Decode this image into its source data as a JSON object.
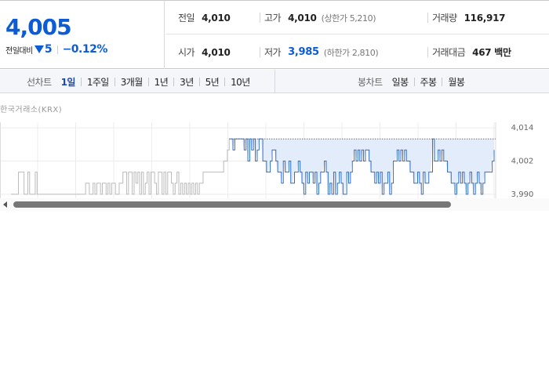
{
  "summary": {
    "price": "4,005",
    "change_label": "전일대비",
    "change_amount": "5",
    "change_percent": "−0.12%",
    "row1": {
      "prev_close_label": "전일",
      "prev_close_value": "4,010",
      "high_label": "고가",
      "high_value": "4,010",
      "upper_limit": "(상한가 5,210)",
      "volume_label": "거래량",
      "volume_value": "116,917"
    },
    "row2": {
      "open_label": "시가",
      "open_value": "4,010",
      "low_label": "저가",
      "low_value": "3,985",
      "lower_limit": "(하한가 2,810)",
      "trade_value_label": "거래대금",
      "trade_value_value": "467 백만"
    }
  },
  "tabs": {
    "line_caption": "선차트",
    "line_periods": [
      "1일",
      "1주일",
      "3개월",
      "1년",
      "3년",
      "5년",
      "10년"
    ],
    "line_active": 0,
    "candle_caption": "봉차트",
    "candle_periods": [
      "일봉",
      "주봉",
      "월봉"
    ]
  },
  "exchange_label": "한국거래소(KRX)",
  "chart_data": {
    "type": "line",
    "ytick_labels": [
      "4,014",
      "4,002",
      "3,990"
    ],
    "yticks": [
      4014,
      4002,
      3990
    ],
    "ylim": [
      3988,
      4016
    ],
    "reference": 4010,
    "x_count": 260,
    "series": [
      {
        "values": [
          3990,
          3990,
          3990,
          3990,
          3998,
          3998,
          3998,
          3990,
          3990,
          3998,
          3990,
          3990,
          3990,
          3998,
          3990,
          3990,
          3990,
          3990,
          3990,
          3990,
          3990,
          3990,
          3990,
          3990,
          3990,
          3990,
          3990,
          3990,
          3990,
          3990,
          3990,
          3990,
          3990,
          3990,
          3990,
          3990,
          3990,
          3990,
          3990,
          3990,
          3994,
          3994,
          3990,
          3990,
          3994,
          3990,
          3994,
          3994,
          3990,
          3994,
          3994,
          3990,
          3994,
          3990,
          3994,
          3994,
          3990,
          3990,
          3994,
          3994,
          3998,
          3998,
          3990,
          3998,
          3998,
          3990,
          3998,
          3994,
          3998,
          3990,
          3998,
          3990,
          3994,
          3998,
          3990,
          3998,
          3998,
          3994,
          3990,
          3998,
          3998,
          3990,
          3998,
          3990,
          3998,
          3998,
          3994,
          3990,
          3994,
          3998,
          3990,
          3994,
          3990,
          3994,
          3990,
          3994,
          3990,
          3994,
          3990,
          3994,
          3990,
          3994,
          3994,
          3998,
          3998,
          3998,
          3998,
          3998,
          3998,
          3998,
          3998,
          3998,
          3998,
          3998,
          4002,
          4002,
          4006,
          4010,
          4010,
          4006,
          4010,
          4010,
          4010,
          4010,
          4010,
          4006,
          4010,
          4002,
          4010,
          4006,
          4010,
          4002,
          4006,
          4010,
          4010,
          4002,
          4002,
          3998,
          3998,
          4002,
          4006,
          4006,
          4002,
          3998,
          3998,
          3994,
          4002,
          3998,
          3998,
          4002,
          3994,
          3994,
          3998,
          3998,
          4002,
          3998,
          3994,
          3990,
          3998,
          3994,
          3998,
          3998,
          3994,
          3998,
          3990,
          3994,
          3998,
          3998,
          4002,
          3998,
          3990,
          3994,
          3990,
          3998,
          3990,
          3994,
          3998,
          3994,
          3990,
          3990,
          3998,
          3994,
          3998,
          4002,
          4006,
          4002,
          4006,
          4002,
          4006,
          4002,
          4006,
          4006,
          4002,
          3998,
          3998,
          3994,
          3998,
          3994,
          3998,
          3990,
          3994,
          3994,
          3998,
          3990,
          3994,
          4002,
          4002,
          4006,
          4002,
          4006,
          4002,
          4006,
          4002,
          4002,
          3998,
          3998,
          3994,
          3994,
          3998,
          3994,
          3990,
          3998,
          3994,
          3994,
          3998,
          3998,
          4010,
          4002,
          4002,
          4006,
          4002,
          4006,
          4002,
          4002,
          3998,
          3998,
          3994,
          3994,
          3990,
          3994,
          3998,
          3994,
          3998,
          3994,
          3990,
          3994,
          3998,
          3994,
          3990,
          3994,
          3998,
          3994,
          3990,
          3994,
          3998,
          3998,
          3998,
          3998,
          4002,
          4006
        ]
      }
    ]
  },
  "colors": {
    "price_down": "#0c5cd6",
    "line_before": "#bbbbbb",
    "line_after": "#2f6fd0",
    "fill": "#e3ecfa",
    "active_tab": "#1d49b8"
  }
}
